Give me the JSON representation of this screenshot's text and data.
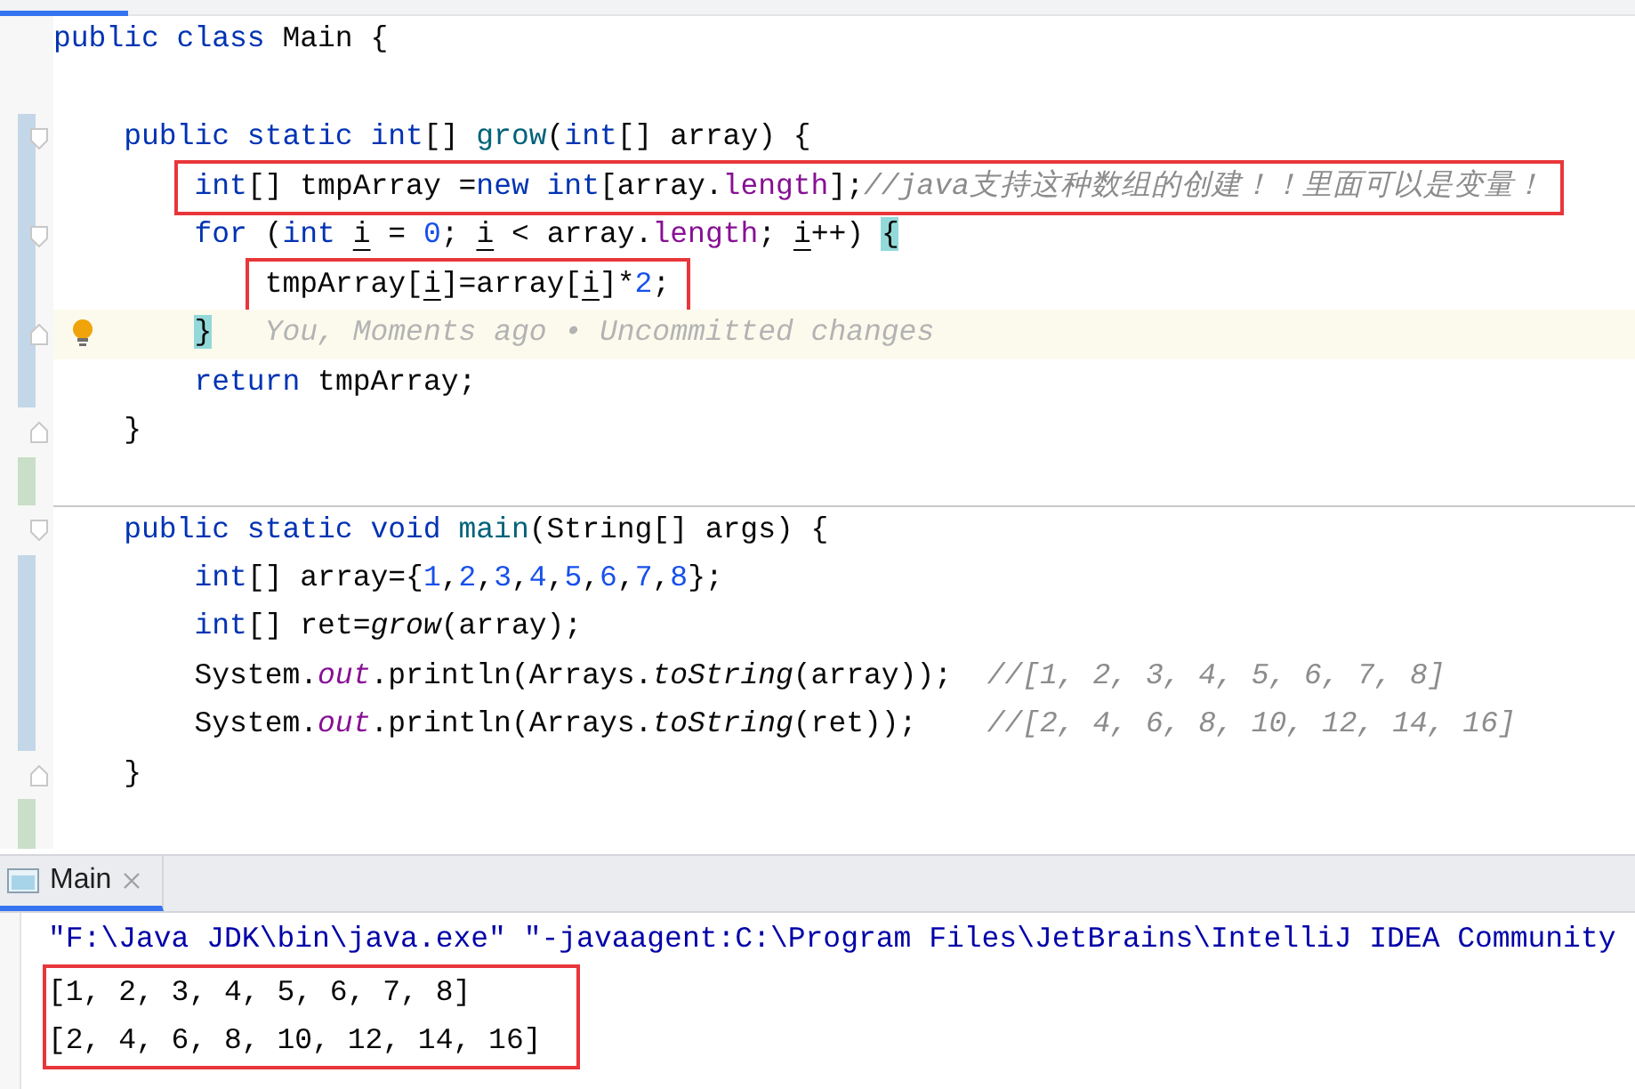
{
  "editor": {
    "lines": [
      {
        "tokens": [
          {
            "kind": "kw",
            "text": "public class"
          },
          {
            "kind": "plain",
            "text": " Main {"
          }
        ]
      },
      {
        "blank": true
      },
      {
        "fold_start": true,
        "modified": true,
        "tokens": [
          {
            "kind": "kw",
            "text": "    public static int"
          },
          {
            "kind": "plain",
            "text": "[] "
          },
          {
            "kind": "fn",
            "text": "grow"
          },
          {
            "kind": "plain",
            "text": "("
          },
          {
            "kind": "kw",
            "text": "int"
          },
          {
            "kind": "plain",
            "text": "[] array) {"
          }
        ]
      },
      {
        "modified": true,
        "boxed": true,
        "tokens": [
          {
            "kind": "kw",
            "text": "        int"
          },
          {
            "kind": "plain",
            "text": "[] tmpArray ="
          },
          {
            "kind": "kw",
            "text": "new int"
          },
          {
            "kind": "plain",
            "text": "[array."
          },
          {
            "kind": "field",
            "text": "length"
          },
          {
            "kind": "plain",
            "text": "];"
          },
          {
            "kind": "comment",
            "text": "//java支持这种数组的创建！！里面可以是变量！"
          }
        ]
      },
      {
        "fold_start": true,
        "modified": true,
        "tokens": [
          {
            "kind": "kw",
            "text": "        for"
          },
          {
            "kind": "plain",
            "text": " ("
          },
          {
            "kind": "kw",
            "text": "int "
          },
          {
            "kind": "var",
            "text": "i"
          },
          {
            "kind": "plain",
            "text": " = "
          },
          {
            "kind": "num",
            "text": "0"
          },
          {
            "kind": "plain",
            "text": "; "
          },
          {
            "kind": "var",
            "text": "i"
          },
          {
            "kind": "plain",
            "text": " < array."
          },
          {
            "kind": "field",
            "text": "length"
          },
          {
            "kind": "plain",
            "text": "; "
          },
          {
            "kind": "var",
            "text": "i"
          },
          {
            "kind": "plain",
            "text": "++) "
          },
          {
            "kind": "brace",
            "text": "{"
          }
        ]
      },
      {
        "modified": true,
        "boxed": true,
        "tokens": [
          {
            "kind": "plain",
            "text": "            tmpArray["
          },
          {
            "kind": "var",
            "text": "i"
          },
          {
            "kind": "plain",
            "text": "]=array["
          },
          {
            "kind": "var",
            "text": "i"
          },
          {
            "kind": "plain",
            "text": "]*"
          },
          {
            "kind": "num",
            "text": "2"
          },
          {
            "kind": "plain",
            "text": ";"
          }
        ]
      },
      {
        "fold_end": true,
        "modified": true,
        "current": true,
        "bulb": true,
        "tokens": [
          {
            "kind": "brace",
            "text": "        }"
          }
        ],
        "hint": "You, Moments ago • Uncommitted changes"
      },
      {
        "modified": true,
        "tokens": [
          {
            "kind": "kw",
            "text": "        return"
          },
          {
            "kind": "plain",
            "text": " tmpArray;"
          }
        ]
      },
      {
        "fold_end": true,
        "tokens": [
          {
            "kind": "plain",
            "text": "    }"
          }
        ]
      },
      {
        "added": true
      },
      {
        "separator": true,
        "fold_start": true,
        "tokens": [
          {
            "kind": "kw",
            "text": "    public static void "
          },
          {
            "kind": "fn",
            "text": "main"
          },
          {
            "kind": "plain",
            "text": "(String[] args) {"
          }
        ]
      },
      {
        "modified": true,
        "tokens": [
          {
            "kind": "kw",
            "text": "        int"
          },
          {
            "kind": "plain",
            "text": "[] array={"
          },
          {
            "kind": "num",
            "text": "1"
          },
          {
            "kind": "plain",
            "text": ","
          },
          {
            "kind": "num",
            "text": "2"
          },
          {
            "kind": "plain",
            "text": ","
          },
          {
            "kind": "num",
            "text": "3"
          },
          {
            "kind": "plain",
            "text": ","
          },
          {
            "kind": "num",
            "text": "4"
          },
          {
            "kind": "plain",
            "text": ","
          },
          {
            "kind": "num",
            "text": "5"
          },
          {
            "kind": "plain",
            "text": ","
          },
          {
            "kind": "num",
            "text": "6"
          },
          {
            "kind": "plain",
            "text": ","
          },
          {
            "kind": "num",
            "text": "7"
          },
          {
            "kind": "plain",
            "text": ","
          },
          {
            "kind": "num",
            "text": "8"
          },
          {
            "kind": "plain",
            "text": "};"
          }
        ]
      },
      {
        "modified": true,
        "tokens": [
          {
            "kind": "kw",
            "text": "        int"
          },
          {
            "kind": "plain",
            "text": "[] ret="
          },
          {
            "kind": "static_call",
            "text": "grow"
          },
          {
            "kind": "plain",
            "text": "(array);"
          }
        ]
      },
      {
        "modified": true,
        "tokens": [
          {
            "kind": "plain",
            "text": "        System."
          },
          {
            "kind": "static_field",
            "text": "out"
          },
          {
            "kind": "plain",
            "text": ".println(Arrays."
          },
          {
            "kind": "static_call",
            "text": "toString"
          },
          {
            "kind": "plain",
            "text": "(array));  "
          },
          {
            "kind": "comment",
            "text": "//[1, 2, 3, 4, 5, 6, 7, 8]"
          }
        ]
      },
      {
        "modified": true,
        "tokens": [
          {
            "kind": "plain",
            "text": "        System."
          },
          {
            "kind": "static_field",
            "text": "out"
          },
          {
            "kind": "plain",
            "text": ".println(Arrays."
          },
          {
            "kind": "static_call",
            "text": "toString"
          },
          {
            "kind": "plain",
            "text": "(ret));    "
          },
          {
            "kind": "comment",
            "text": "//[2, 4, 6, 8, 10, 12, 14, 16]"
          }
        ]
      },
      {
        "fold_end": true,
        "tokens": [
          {
            "kind": "plain",
            "text": "    }"
          }
        ]
      },
      {
        "added": true
      }
    ]
  },
  "run_panel": {
    "tabs": [
      {
        "label": "Main",
        "selected": true,
        "closable": true
      }
    ],
    "console": [
      {
        "kind": "command",
        "boxed": false,
        "text": "\"F:\\Java JDK\\bin\\java.exe\" \"-javaagent:C:\\Program Files\\JetBrains\\IntelliJ IDEA Community"
      },
      {
        "kind": "output",
        "boxed": true,
        "text": "[1, 2, 3, 4, 5, 6, 7, 8]"
      },
      {
        "kind": "output",
        "boxed": true,
        "text": "[2, 4, 6, 8, 10, 12, 14, 16]"
      }
    ]
  }
}
